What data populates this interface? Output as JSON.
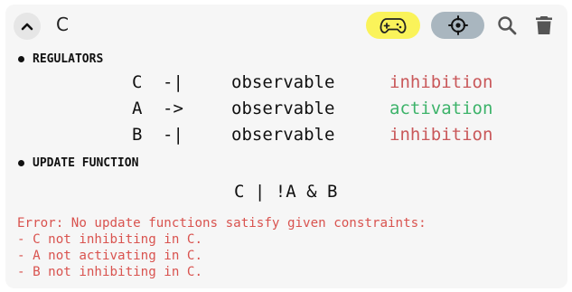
{
  "header": {
    "title": "C",
    "icons": {
      "collapse": "chevron-up-icon",
      "game": "gamepad-icon",
      "target": "crosshair-icon",
      "search": "search-icon",
      "delete": "trash-icon"
    }
  },
  "regulators": {
    "heading": "REGULATORS",
    "rows": [
      {
        "source": "C",
        "arrow": "-|",
        "observable": "observable",
        "effect": "inhibition",
        "effect_color": "#c9585a"
      },
      {
        "source": "A",
        "arrow": "->",
        "observable": "observable",
        "effect": "activation",
        "effect_color": "#3db36a"
      },
      {
        "source": "B",
        "arrow": "-|",
        "observable": "observable",
        "effect": "inhibition",
        "effect_color": "#c9585a"
      }
    ]
  },
  "update_function": {
    "heading": "UPDATE FUNCTION",
    "expression": "C | !A & B"
  },
  "error": {
    "lines": [
      "Error: No update functions satisfy given constraints:",
      "- C not inhibiting in C.",
      "- A not activating in C.",
      "- B not inhibiting in C."
    ]
  },
  "colors": {
    "game_pill": "#faf35a",
    "target_pill": "#a9b6bf",
    "error": "#d9534f"
  }
}
